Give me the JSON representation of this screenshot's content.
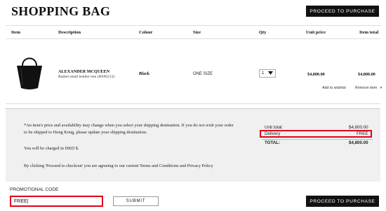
{
  "header": {
    "title": "SHOPPING BAG",
    "proceed_label": "PROCEED TO PURCHASE"
  },
  "table": {
    "columns": [
      "Item",
      "Description",
      "Colour",
      "Size",
      "Qty",
      "Unit price",
      "Item total"
    ]
  },
  "product": {
    "image_icon": "handbag-image",
    "brand": "ALEXANDER MCQUEEN",
    "description": "Basket small leather tote (HS96213)",
    "colour": "Black",
    "size": "ONE SIZE",
    "qty": "1",
    "unit_price": "$4,800.00",
    "item_total": "$4,800.00",
    "add_to_wishlist": "Add to wishlist",
    "remove_item": "Remove item"
  },
  "notes": {
    "line1": "*An item's price and availability may change when you select your shipping destination. If you do not wish your order",
    "line2": "to be shipped to Hong Kong, please update your shipping destination.",
    "currency": "You will be charged in HKD $.",
    "terms": "By clicking 'Proceed to checkout' you are agreeing to our current Terms and Conditions and Privacy Policy"
  },
  "summary": {
    "unit_total_label": "Unit total:",
    "unit_total_value": "$4,800.00",
    "delivery_label": "Delivery",
    "delivery_value": "FREE",
    "total_label": "TOTAL:",
    "total_value": "$4,800.00"
  },
  "promo": {
    "label": "PROMOTIONAL CODE",
    "value": "FREE|",
    "submit_label": "SUBMIT"
  },
  "footer": {
    "proceed_label": "PROCEED TO PURCHASE"
  },
  "colors": {
    "highlight": "#e0001b",
    "button": "#111111",
    "panel": "#f0f0f0"
  }
}
